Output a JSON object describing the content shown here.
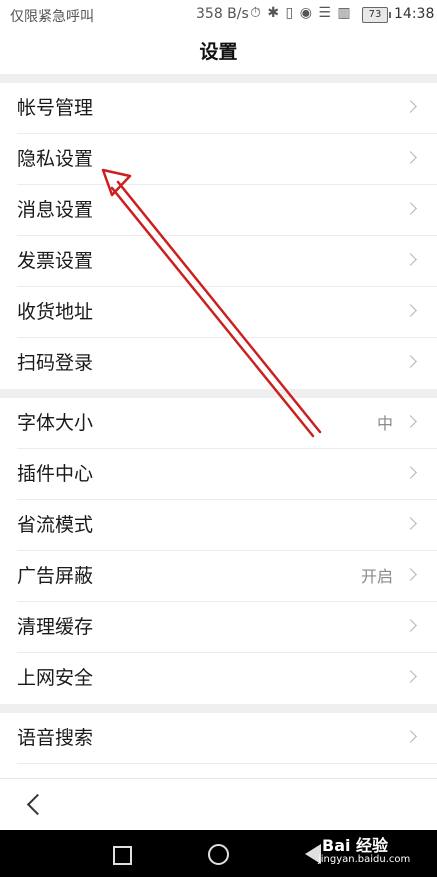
{
  "status_bar": {
    "carrier": "仅限紧急呼叫",
    "speed": "358 B/s",
    "icons": "⏱ ✱ ▯ ◉ ☰ ▥",
    "battery": "73",
    "time": "14:38"
  },
  "header": {
    "title": "设置"
  },
  "groups": [
    {
      "items": [
        {
          "label": "帐号管理"
        },
        {
          "label": "隐私设置"
        },
        {
          "label": "消息设置"
        },
        {
          "label": "发票设置"
        },
        {
          "label": "收货地址"
        },
        {
          "label": "扫码登录"
        }
      ]
    },
    {
      "items": [
        {
          "label": "字体大小",
          "value": "中"
        },
        {
          "label": "插件中心"
        },
        {
          "label": "省流模式"
        },
        {
          "label": "广告屏蔽",
          "value": "开启"
        },
        {
          "label": "清理缓存"
        },
        {
          "label": "上网安全"
        }
      ]
    },
    {
      "items": [
        {
          "label": "语音搜索"
        }
      ]
    }
  ],
  "watermark": {
    "brand": "Bai 经验",
    "url": "jingyan.baidu.com"
  },
  "annotation": {
    "color": "#cc1f1f",
    "target": "隐私设置"
  }
}
